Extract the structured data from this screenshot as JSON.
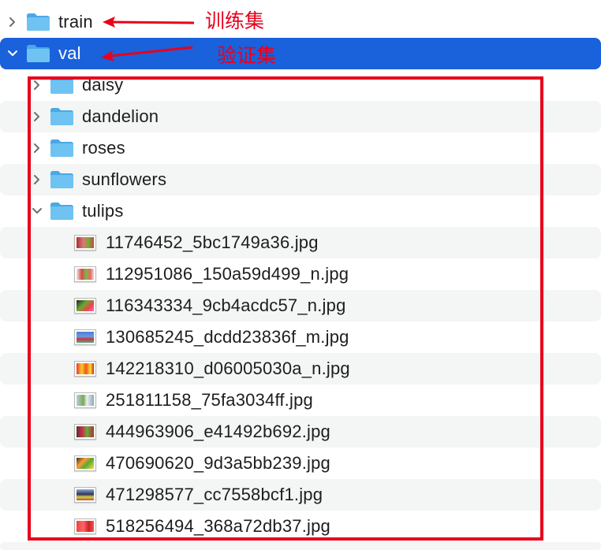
{
  "tree": {
    "train": {
      "name": "train"
    },
    "val": {
      "name": "val"
    },
    "subfolders": [
      {
        "name": "daisy"
      },
      {
        "name": "dandelion"
      },
      {
        "name": "roses"
      },
      {
        "name": "sunflowers"
      },
      {
        "name": "tulips"
      }
    ],
    "files": [
      {
        "name": "11746452_5bc1749a36.jpg"
      },
      {
        "name": "112951086_150a59d499_n.jpg"
      },
      {
        "name": "116343334_9cb4acdc57_n.jpg"
      },
      {
        "name": "130685245_dcdd23836f_m.jpg"
      },
      {
        "name": "142218310_d06005030a_n.jpg"
      },
      {
        "name": "251811158_75fa3034ff.jpg"
      },
      {
        "name": "444963906_e41492b692.jpg"
      },
      {
        "name": "470690620_9d3a5bb239.jpg"
      },
      {
        "name": "471298577_cc7558bcf1.jpg"
      },
      {
        "name": "518256494_368a72db37.jpg"
      }
    ]
  },
  "annotations": {
    "train_label": "训练集",
    "val_label": "验证集",
    "color": "#e8001c"
  },
  "colors": {
    "selection": "#1a61dc",
    "folder": "#5bb8ee"
  }
}
